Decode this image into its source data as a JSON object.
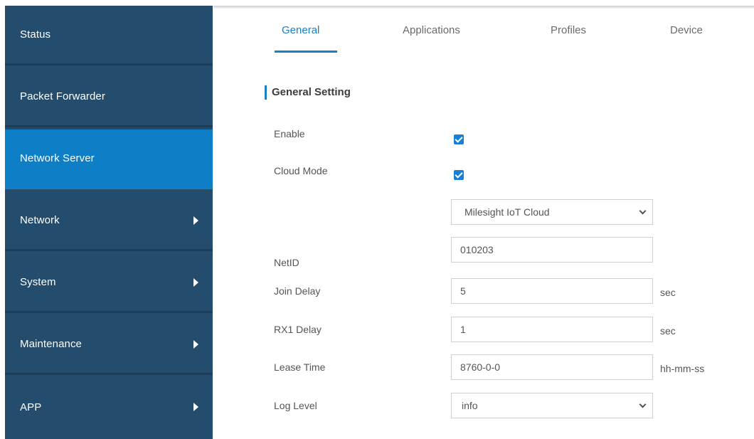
{
  "sidebar": {
    "items": [
      {
        "label": "Status"
      },
      {
        "label": "Packet Forwarder"
      },
      {
        "label": "Network Server"
      },
      {
        "label": "Network"
      },
      {
        "label": "System"
      },
      {
        "label": "Maintenance"
      },
      {
        "label": "APP"
      }
    ],
    "colors": {
      "background": "#244c6d",
      "active": "#0e7ec6"
    }
  },
  "tabs": [
    {
      "label": "General"
    },
    {
      "label": "Applications"
    },
    {
      "label": "Profiles"
    },
    {
      "label": "Device"
    }
  ],
  "section": {
    "title": "General Setting"
  },
  "form": {
    "enable": {
      "label": "Enable",
      "checked": true
    },
    "cloud_mode": {
      "label": "Cloud Mode",
      "checked": true,
      "selected": "Milesight IoT Cloud"
    },
    "netid": {
      "label": "NetID",
      "value": "010203"
    },
    "join_delay": {
      "label": "Join Delay",
      "value": "5",
      "unit": "sec"
    },
    "rx1_delay": {
      "label": "RX1 Delay",
      "value": "1",
      "unit": "sec"
    },
    "lease_time": {
      "label": "Lease Time",
      "value": "8760-0-0",
      "unit": "hh-mm-ss"
    },
    "log_level": {
      "label": "Log Level",
      "selected": "info"
    }
  },
  "accent_color": "#1680c8"
}
